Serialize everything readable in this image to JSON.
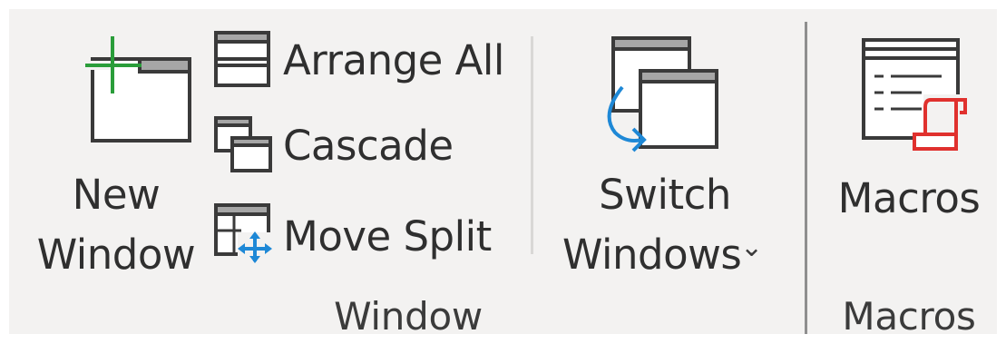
{
  "window_group": {
    "label": "Window",
    "new_window": {
      "line1": "New",
      "line2": "Window",
      "icon": "new-window-icon"
    },
    "arrange_all": {
      "label": "Arrange All",
      "icon": "arrange-all-icon"
    },
    "cascade": {
      "label": "Cascade",
      "icon": "cascade-icon"
    },
    "move_split": {
      "label": "Move Split",
      "icon": "move-split-icon"
    },
    "switch_windows": {
      "line1": "Switch",
      "line2": "Windows",
      "dropdown_glyph": "⌄",
      "icon": "switch-windows-icon"
    }
  },
  "macros_group": {
    "label": "Macros",
    "macros_button": {
      "label": "Macros",
      "icon": "macros-icon"
    }
  },
  "colors": {
    "ribbon_bg": "#f3f2f1",
    "icon_stroke": "#3a3a3a",
    "title_bar": "#a6a6a6",
    "green_plus": "#2a9d3a",
    "blue_accent": "#1e88d6",
    "red_accent": "#e0312e"
  }
}
